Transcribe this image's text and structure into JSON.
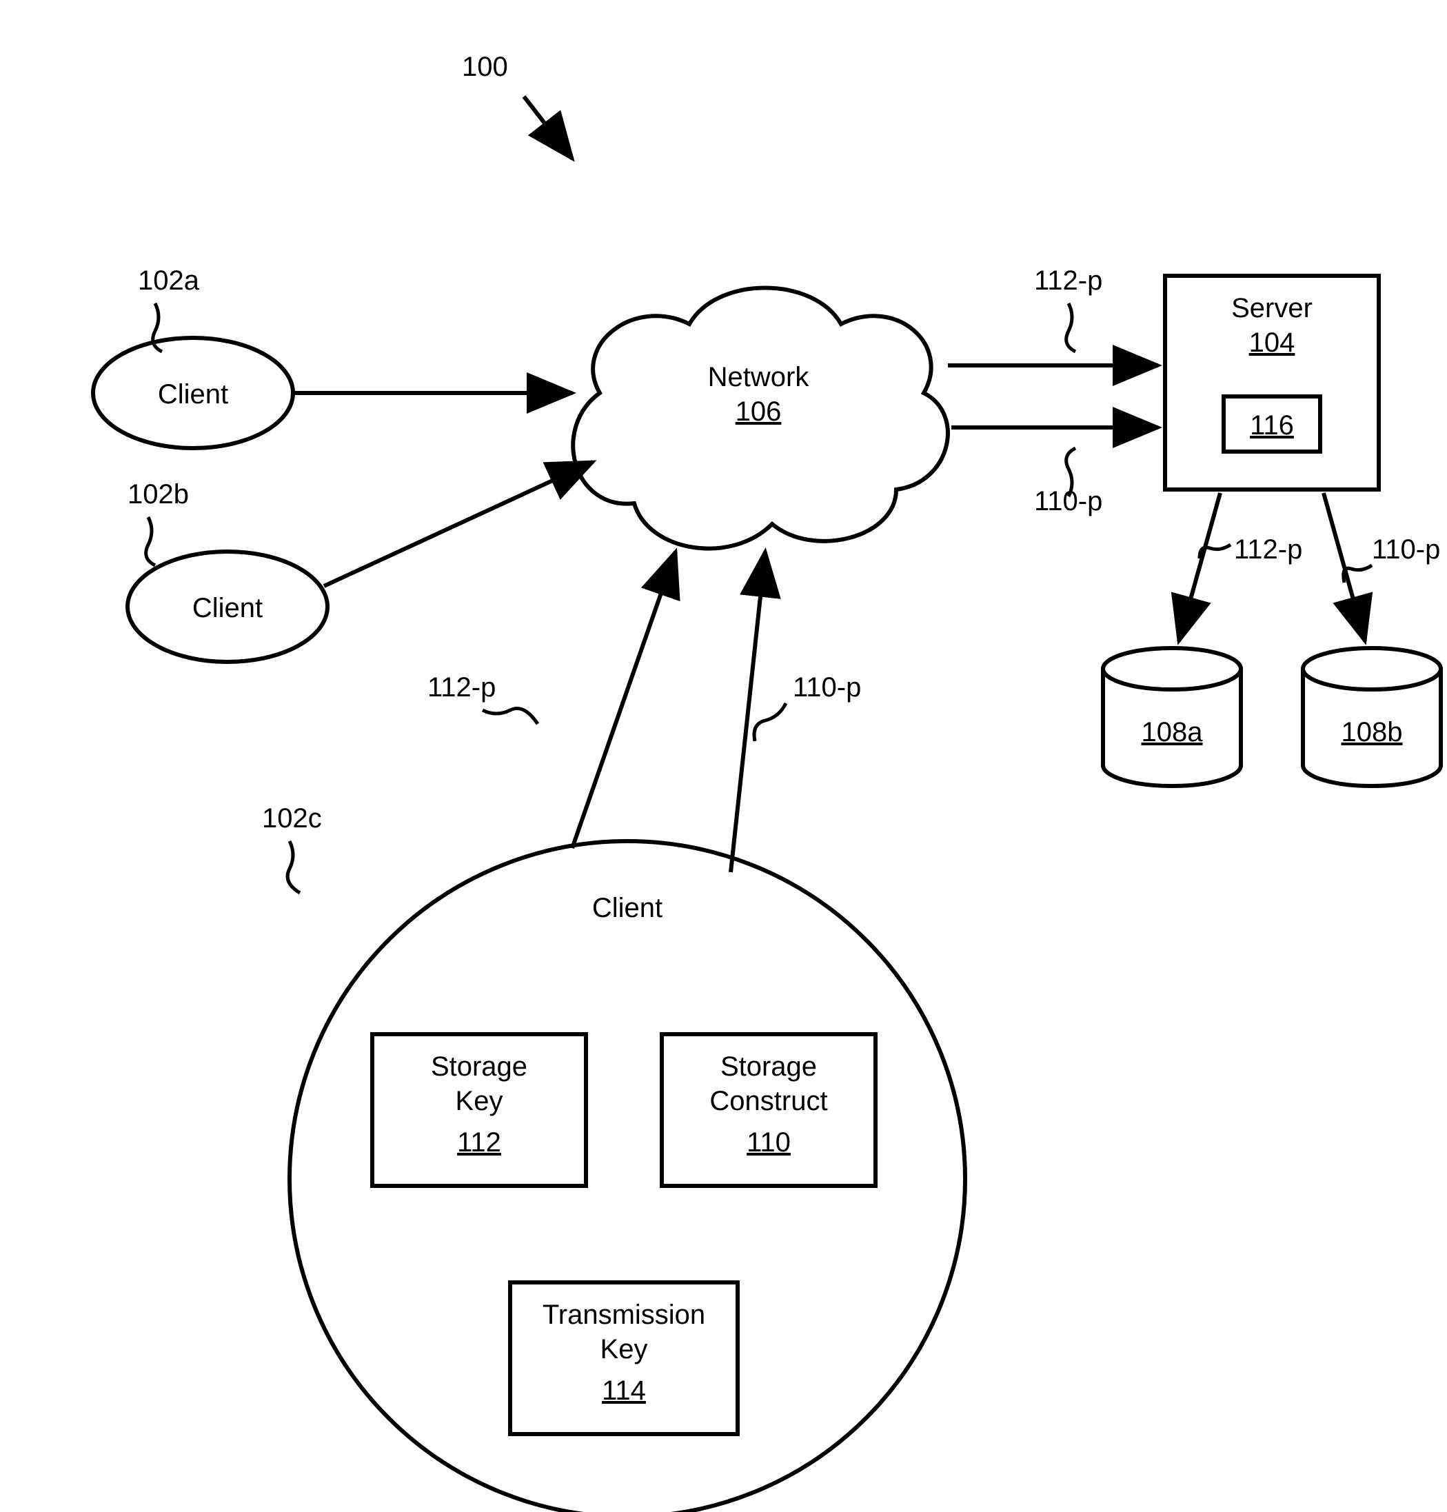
{
  "figure": {
    "id": "100",
    "clients": {
      "a": {
        "ref": "102a",
        "label": "Client"
      },
      "b": {
        "ref": "102b",
        "label": "Client"
      },
      "c": {
        "ref": "102c",
        "label": "Client"
      }
    },
    "network": {
      "ref": "106",
      "label": "Network"
    },
    "server": {
      "ref": "104",
      "label": "Server",
      "inner_ref": "116"
    },
    "storage_units": {
      "a": {
        "ref": "108a"
      },
      "b": {
        "ref": "108b"
      }
    },
    "client_c_components": {
      "storage_key": {
        "label_line1": "Storage",
        "label_line2": "Key",
        "ref": "112"
      },
      "storage_construct": {
        "label_line1": "Storage",
        "label_line2": "Construct",
        "ref": "110"
      },
      "transmission_key": {
        "label_line1": "Transmission",
        "label_line2": "Key",
        "ref": "114"
      }
    },
    "flow_labels": {
      "upper": "112-p",
      "lower": "110-p"
    }
  }
}
